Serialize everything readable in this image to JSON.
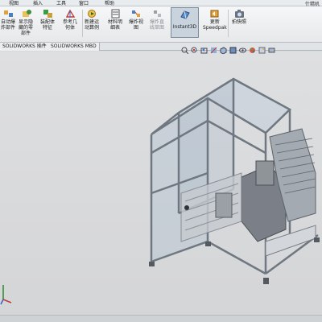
{
  "menubar": {
    "menus": [
      "插入(I)",
      "视图(V)",
      "工具(T)",
      "窗口(W)",
      "帮助(H)"
    ],
    "visible_menus": [
      "视图",
      "插入",
      "工具",
      "窗口",
      "帮助"
    ],
    "search_text": "什精机"
  },
  "ribbon": {
    "buttons": [
      {
        "label": "自动爆\n炸部件",
        "icon": "explode-icon"
      },
      {
        "label": "显示隐\n藏的零\n部件",
        "icon": "show-hidden-icon"
      },
      {
        "label": "装配体\n特征",
        "icon": "assembly-feature-icon"
      },
      {
        "label": "参考几\n何体",
        "icon": "reference-geometry-icon"
      },
      {
        "label": "新建运\n动算例",
        "icon": "motion-study-icon"
      },
      {
        "label": "材料明\n细表",
        "icon": "bom-icon"
      },
      {
        "label": "爆炸视\n图",
        "icon": "exploded-view-icon"
      },
      {
        "label": "爆炸直\n线草图",
        "icon": "explode-line-sketch-icon"
      },
      {
        "label": "Instant3D",
        "icon": "instant3d-icon"
      },
      {
        "label": "更新\nSpeedpak",
        "icon": "speedpak-icon"
      },
      {
        "label": "拍快照",
        "icon": "snapshot-icon"
      }
    ]
  },
  "tabs": [
    "SOLIDWORKS 插件",
    "SOLIDWORKS MBD"
  ],
  "viewtools": [
    "zoom-fit-icon",
    "zoom-area-icon",
    "previous-view-icon",
    "section-view-icon",
    "view-orientation-icon",
    "display-style-icon",
    "hide-show-icon",
    "appearance-icon",
    "scene-icon",
    "view-settings-icon"
  ],
  "colors": {
    "accent": "#c9d3de",
    "frame": "#8a9098",
    "glass": "#b8c4cf"
  }
}
